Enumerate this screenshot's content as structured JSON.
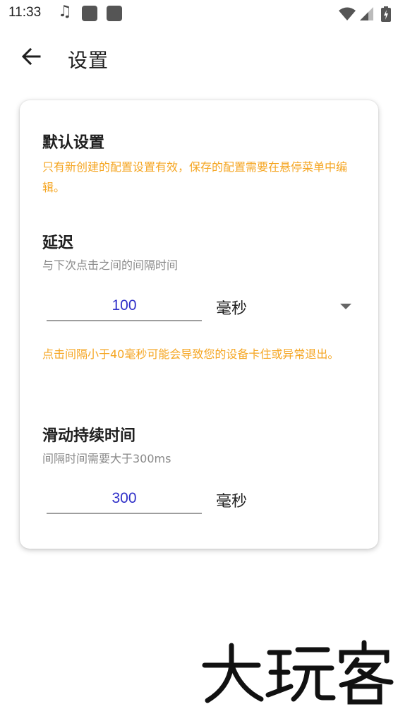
{
  "status_bar": {
    "time": "11:33"
  },
  "app_bar": {
    "title": "设置"
  },
  "default_settings": {
    "title": "默认设置",
    "note": "只有新创建的配置设置有效，保存的配置需要在悬停菜单中编辑。"
  },
  "delay": {
    "title": "延迟",
    "subtitle": "与下次点击之间的间隔时间",
    "value": "100",
    "unit": "毫秒",
    "warning": "点击间隔小于40毫秒可能会导致您的设备卡住或异常退出。"
  },
  "swipe_duration": {
    "title": "滑动持续时间",
    "subtitle": "间隔时间需要大于300ms",
    "value": "300",
    "unit": "毫秒"
  },
  "watermark": {
    "text": "大玩客"
  },
  "colors": {
    "note": "#f5a623",
    "input_text": "#3030c8"
  }
}
